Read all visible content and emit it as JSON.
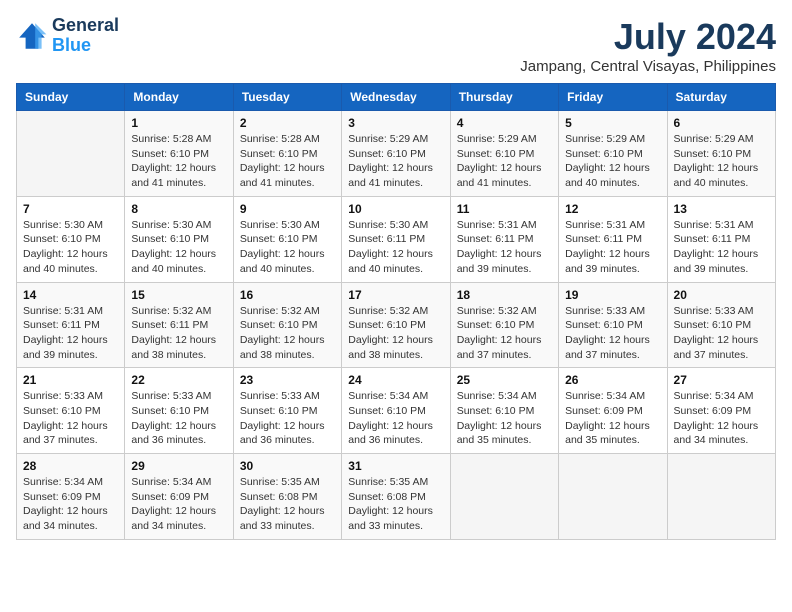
{
  "header": {
    "logo_line1": "General",
    "logo_line2": "Blue",
    "month": "July 2024",
    "location": "Jampang, Central Visayas, Philippines"
  },
  "weekdays": [
    "Sunday",
    "Monday",
    "Tuesday",
    "Wednesday",
    "Thursday",
    "Friday",
    "Saturday"
  ],
  "weeks": [
    [
      {
        "day": "",
        "info": ""
      },
      {
        "day": "1",
        "info": "Sunrise: 5:28 AM\nSunset: 6:10 PM\nDaylight: 12 hours\nand 41 minutes."
      },
      {
        "day": "2",
        "info": "Sunrise: 5:28 AM\nSunset: 6:10 PM\nDaylight: 12 hours\nand 41 minutes."
      },
      {
        "day": "3",
        "info": "Sunrise: 5:29 AM\nSunset: 6:10 PM\nDaylight: 12 hours\nand 41 minutes."
      },
      {
        "day": "4",
        "info": "Sunrise: 5:29 AM\nSunset: 6:10 PM\nDaylight: 12 hours\nand 41 minutes."
      },
      {
        "day": "5",
        "info": "Sunrise: 5:29 AM\nSunset: 6:10 PM\nDaylight: 12 hours\nand 40 minutes."
      },
      {
        "day": "6",
        "info": "Sunrise: 5:29 AM\nSunset: 6:10 PM\nDaylight: 12 hours\nand 40 minutes."
      }
    ],
    [
      {
        "day": "7",
        "info": "Sunrise: 5:30 AM\nSunset: 6:10 PM\nDaylight: 12 hours\nand 40 minutes."
      },
      {
        "day": "8",
        "info": "Sunrise: 5:30 AM\nSunset: 6:10 PM\nDaylight: 12 hours\nand 40 minutes."
      },
      {
        "day": "9",
        "info": "Sunrise: 5:30 AM\nSunset: 6:10 PM\nDaylight: 12 hours\nand 40 minutes."
      },
      {
        "day": "10",
        "info": "Sunrise: 5:30 AM\nSunset: 6:11 PM\nDaylight: 12 hours\nand 40 minutes."
      },
      {
        "day": "11",
        "info": "Sunrise: 5:31 AM\nSunset: 6:11 PM\nDaylight: 12 hours\nand 39 minutes."
      },
      {
        "day": "12",
        "info": "Sunrise: 5:31 AM\nSunset: 6:11 PM\nDaylight: 12 hours\nand 39 minutes."
      },
      {
        "day": "13",
        "info": "Sunrise: 5:31 AM\nSunset: 6:11 PM\nDaylight: 12 hours\nand 39 minutes."
      }
    ],
    [
      {
        "day": "14",
        "info": "Sunrise: 5:31 AM\nSunset: 6:11 PM\nDaylight: 12 hours\nand 39 minutes."
      },
      {
        "day": "15",
        "info": "Sunrise: 5:32 AM\nSunset: 6:11 PM\nDaylight: 12 hours\nand 38 minutes."
      },
      {
        "day": "16",
        "info": "Sunrise: 5:32 AM\nSunset: 6:10 PM\nDaylight: 12 hours\nand 38 minutes."
      },
      {
        "day": "17",
        "info": "Sunrise: 5:32 AM\nSunset: 6:10 PM\nDaylight: 12 hours\nand 38 minutes."
      },
      {
        "day": "18",
        "info": "Sunrise: 5:32 AM\nSunset: 6:10 PM\nDaylight: 12 hours\nand 37 minutes."
      },
      {
        "day": "19",
        "info": "Sunrise: 5:33 AM\nSunset: 6:10 PM\nDaylight: 12 hours\nand 37 minutes."
      },
      {
        "day": "20",
        "info": "Sunrise: 5:33 AM\nSunset: 6:10 PM\nDaylight: 12 hours\nand 37 minutes."
      }
    ],
    [
      {
        "day": "21",
        "info": "Sunrise: 5:33 AM\nSunset: 6:10 PM\nDaylight: 12 hours\nand 37 minutes."
      },
      {
        "day": "22",
        "info": "Sunrise: 5:33 AM\nSunset: 6:10 PM\nDaylight: 12 hours\nand 36 minutes."
      },
      {
        "day": "23",
        "info": "Sunrise: 5:33 AM\nSunset: 6:10 PM\nDaylight: 12 hours\nand 36 minutes."
      },
      {
        "day": "24",
        "info": "Sunrise: 5:34 AM\nSunset: 6:10 PM\nDaylight: 12 hours\nand 36 minutes."
      },
      {
        "day": "25",
        "info": "Sunrise: 5:34 AM\nSunset: 6:10 PM\nDaylight: 12 hours\nand 35 minutes."
      },
      {
        "day": "26",
        "info": "Sunrise: 5:34 AM\nSunset: 6:09 PM\nDaylight: 12 hours\nand 35 minutes."
      },
      {
        "day": "27",
        "info": "Sunrise: 5:34 AM\nSunset: 6:09 PM\nDaylight: 12 hours\nand 34 minutes."
      }
    ],
    [
      {
        "day": "28",
        "info": "Sunrise: 5:34 AM\nSunset: 6:09 PM\nDaylight: 12 hours\nand 34 minutes."
      },
      {
        "day": "29",
        "info": "Sunrise: 5:34 AM\nSunset: 6:09 PM\nDaylight: 12 hours\nand 34 minutes."
      },
      {
        "day": "30",
        "info": "Sunrise: 5:35 AM\nSunset: 6:08 PM\nDaylight: 12 hours\nand 33 minutes."
      },
      {
        "day": "31",
        "info": "Sunrise: 5:35 AM\nSunset: 6:08 PM\nDaylight: 12 hours\nand 33 minutes."
      },
      {
        "day": "",
        "info": ""
      },
      {
        "day": "",
        "info": ""
      },
      {
        "day": "",
        "info": ""
      }
    ]
  ]
}
